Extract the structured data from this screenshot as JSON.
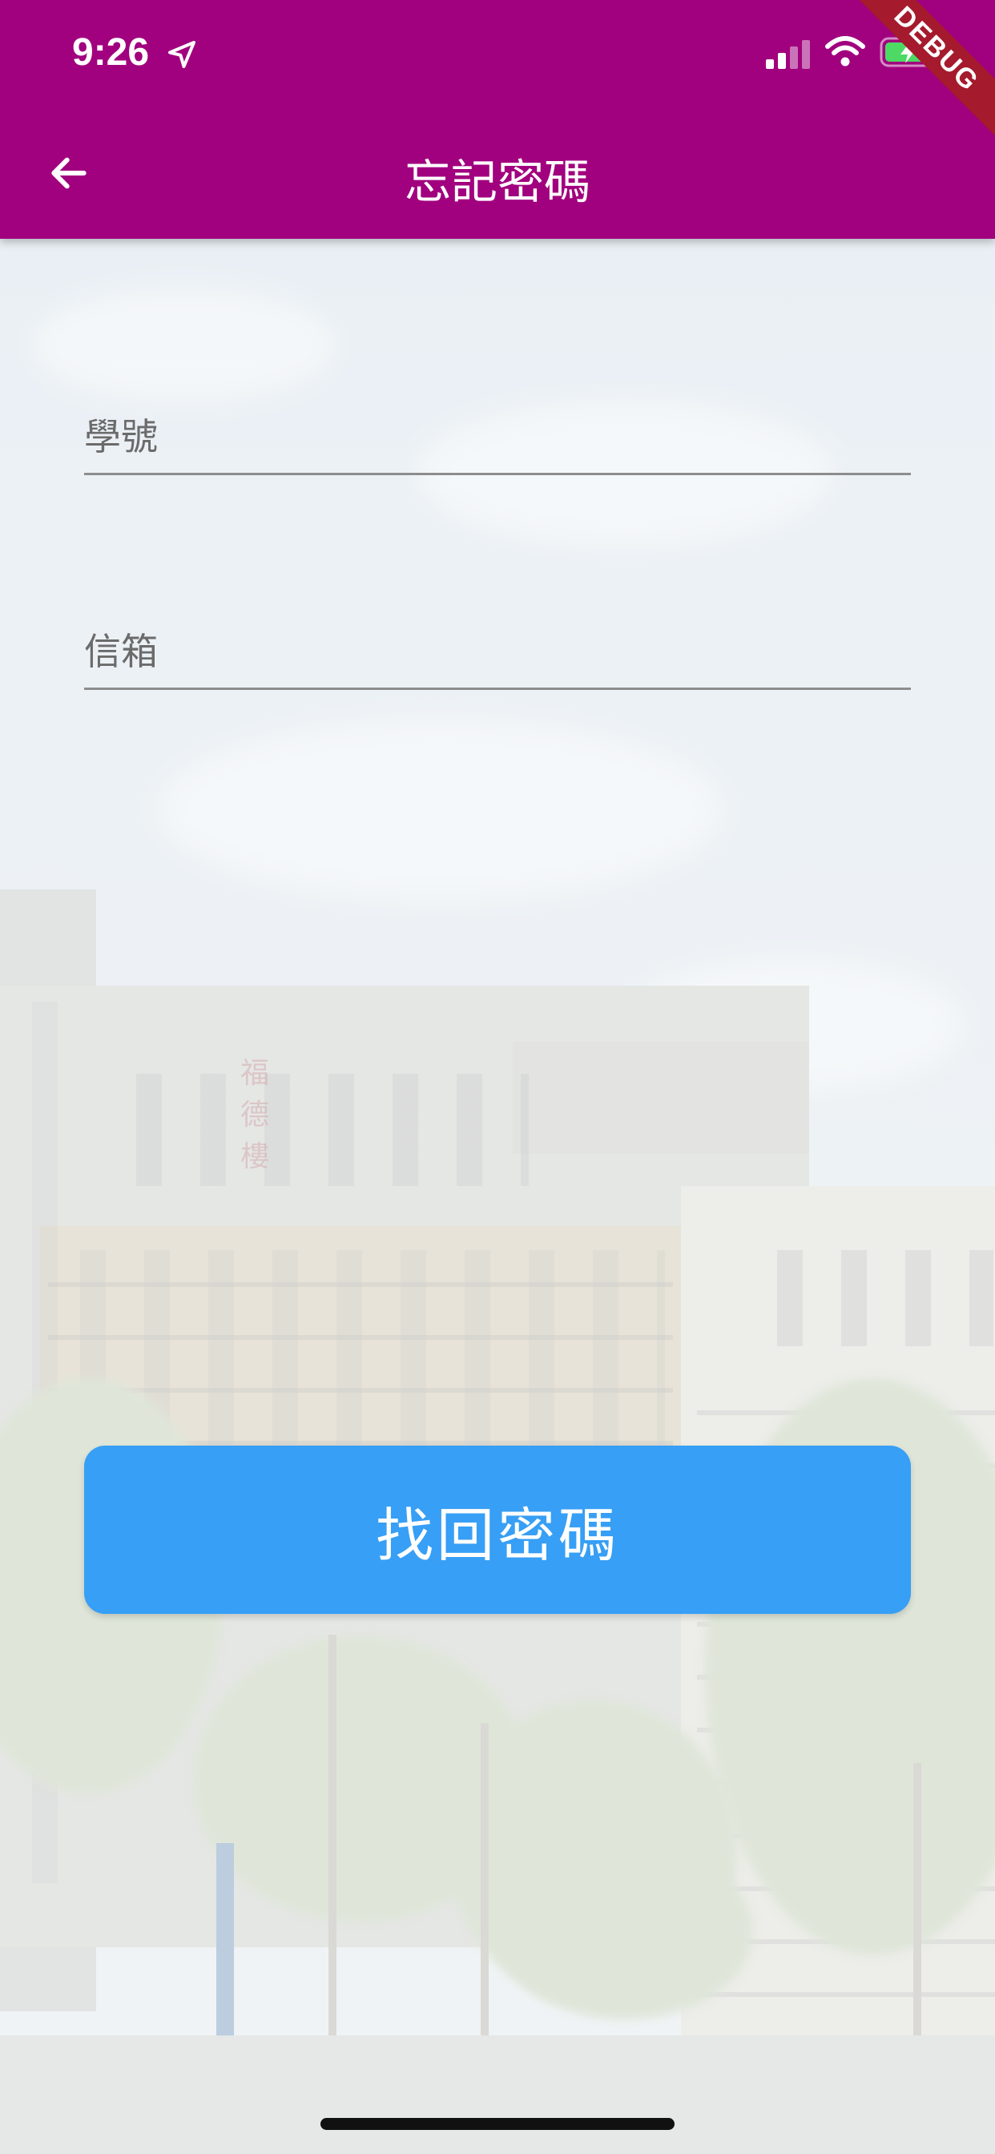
{
  "status_bar": {
    "time": "9:26"
  },
  "debug_banner": "DEBUG",
  "app_bar": {
    "title": "忘記密碼"
  },
  "form": {
    "student_id_placeholder": "學號",
    "email_placeholder": "信箱",
    "submit_label": "找回密碼"
  },
  "colors": {
    "app_bar": "#a1007e",
    "button": "#379ff5",
    "debug_banner": "#a51a2d"
  },
  "icons": {
    "back": "arrow-left-icon",
    "location": "location-arrow-icon",
    "signal": "cellular-signal-icon",
    "wifi": "wifi-icon",
    "battery": "battery-charging-icon"
  }
}
